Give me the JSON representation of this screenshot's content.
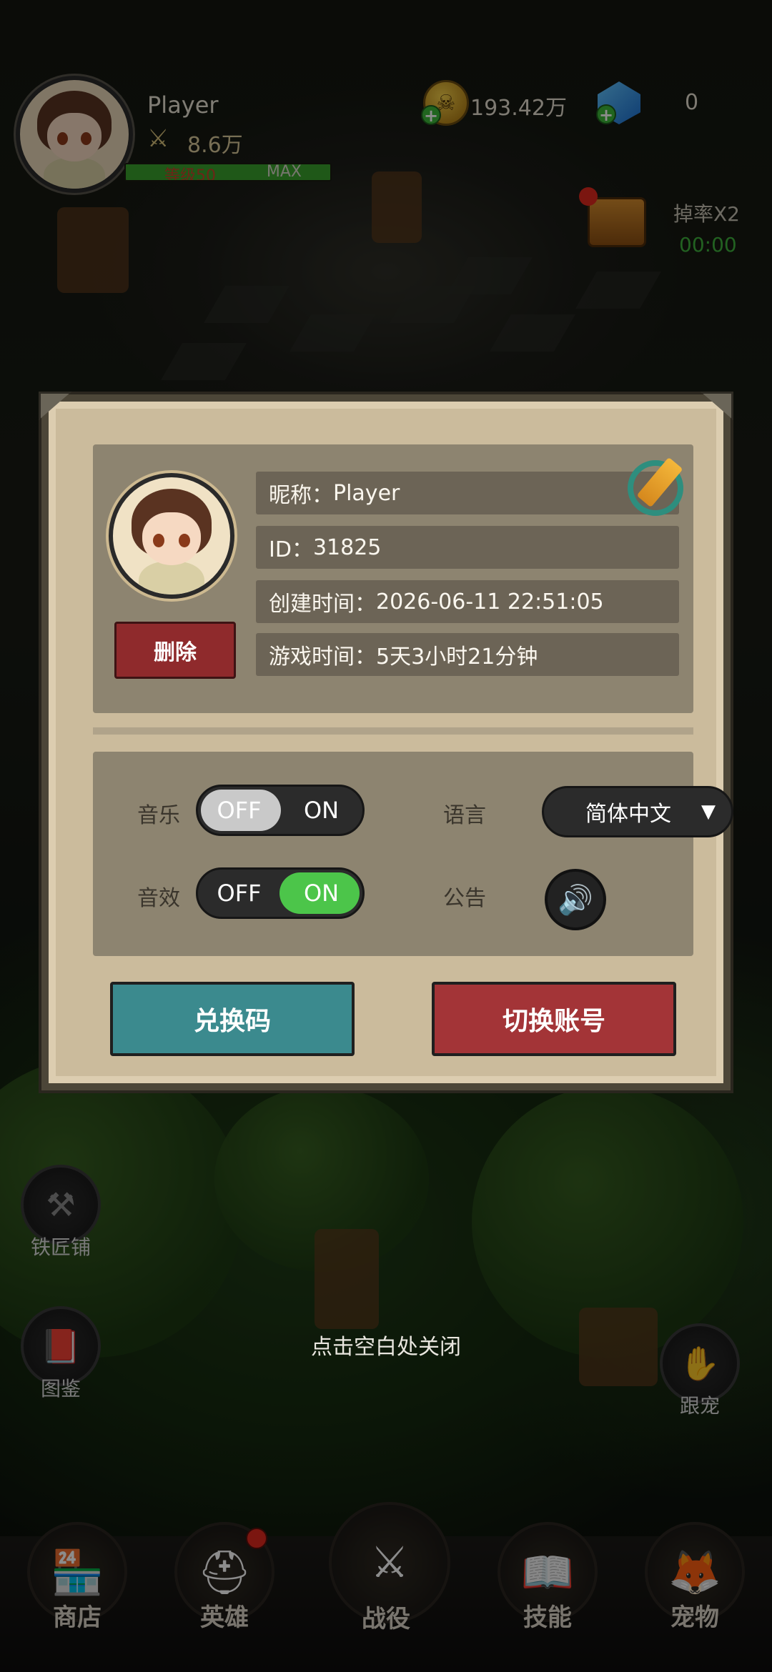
{
  "hud": {
    "player_name": "Player",
    "power": "8.6万",
    "level_text": "等级50",
    "level_max": "MAX",
    "level_progress": 1.0,
    "coins": "193.42万",
    "gems": "0",
    "drop_rate_label": "掉率X2",
    "drop_rate_timer": "00:00"
  },
  "dialog": {
    "nickname_label": "昵称：",
    "nickname": "Player",
    "id_label": "ID：",
    "id": "31825",
    "created_label": "创建时间：",
    "created": "2026-06-11 22:51:05",
    "playtime_label": "游戏时间：",
    "playtime": "5天3小时21分钟",
    "delete_label": "删除",
    "settings": {
      "music_label": "音乐",
      "music_off": "OFF",
      "music_on": "ON",
      "music_state": "off",
      "sfx_label": "音效",
      "sfx_off": "OFF",
      "sfx_on": "ON",
      "sfx_state": "on",
      "language_label": "语言",
      "language_value": "简体中文",
      "notice_label": "公告"
    },
    "redeem_label": "兑换码",
    "switch_account_label": "切换账号"
  },
  "close_hint": "点击空白处关闭",
  "side": {
    "blacksmith": "铁匠铺",
    "codex": "图鉴",
    "follow_pet": "跟宠"
  },
  "nav": {
    "shop": "商店",
    "heroes": "英雄",
    "battle": "战役",
    "skills": "技能",
    "pets": "宠物"
  },
  "colors": {
    "toggle_on": "#4cc54a",
    "toggle_off": "#c9c9c9",
    "teal_button": "#3b8a8e",
    "red_button": "#a33437",
    "panel": "#8d8470"
  },
  "icons": [
    "skull-coin-icon",
    "gem-icon",
    "sword-icon",
    "chest-icon",
    "edit-icon",
    "speaker-icon",
    "hammer-icon",
    "book-icon",
    "hand-icon",
    "shop-icon",
    "helmet-icon",
    "crossed-swords-icon",
    "spellbook-icon",
    "fox-icon"
  ]
}
